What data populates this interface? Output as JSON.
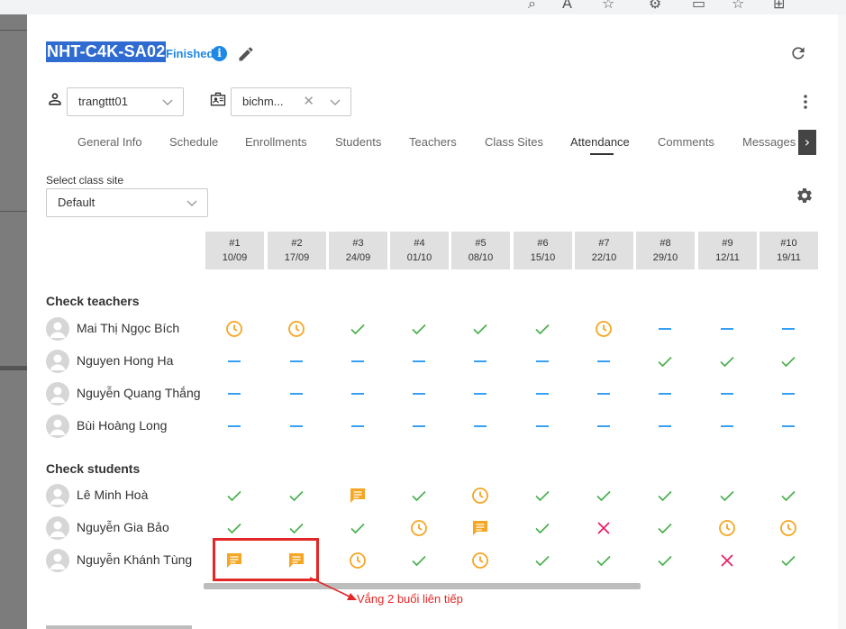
{
  "header": {
    "class_code": "NHT-C4K-SA02",
    "status": "Finished",
    "info_glyph": "i"
  },
  "assignees": {
    "owner": "trangttt01",
    "consultant": "bichm...",
    "clear_glyph": "✕"
  },
  "tabs": [
    {
      "label": "General Info"
    },
    {
      "label": "Schedule"
    },
    {
      "label": "Enrollments"
    },
    {
      "label": "Students"
    },
    {
      "label": "Teachers"
    },
    {
      "label": "Class Sites"
    },
    {
      "label": "Attendance",
      "active": true
    },
    {
      "label": "Comments"
    },
    {
      "label": "Messages"
    }
  ],
  "tab_scroll_glyph": "›",
  "class_site": {
    "label": "Select class site",
    "value": "Default"
  },
  "sessions": [
    {
      "num": "#1",
      "date": "10/09"
    },
    {
      "num": "#2",
      "date": "17/09"
    },
    {
      "num": "#3",
      "date": "24/09"
    },
    {
      "num": "#4",
      "date": "01/10"
    },
    {
      "num": "#5",
      "date": "08/10"
    },
    {
      "num": "#6",
      "date": "15/10"
    },
    {
      "num": "#7",
      "date": "22/10"
    },
    {
      "num": "#8",
      "date": "29/10"
    },
    {
      "num": "#9",
      "date": "12/11"
    },
    {
      "num": "#10",
      "date": "19/11"
    }
  ],
  "teachers_title": "Check teachers",
  "teachers": [
    {
      "name": "Mai Thị Ngọc Bích",
      "marks": [
        "late",
        "late",
        "present",
        "present",
        "present",
        "present",
        "late",
        "none",
        "none",
        "none"
      ]
    },
    {
      "name": "Nguyen Hong Ha",
      "marks": [
        "none",
        "none",
        "none",
        "none",
        "none",
        "none",
        "none",
        "present",
        "present",
        "present"
      ]
    },
    {
      "name": "Nguyễn Quang Thắng",
      "marks": [
        "none",
        "none",
        "none",
        "none",
        "none",
        "none",
        "none",
        "none",
        "none",
        "none"
      ]
    },
    {
      "name": "Bùi Hoàng Long",
      "marks": [
        "none",
        "none",
        "none",
        "none",
        "none",
        "none",
        "none",
        "none",
        "none",
        "none"
      ]
    }
  ],
  "students_title": "Check students",
  "students": [
    {
      "name": "Lê Minh Hoà",
      "marks": [
        "present",
        "present",
        "excused",
        "present",
        "late",
        "present",
        "present",
        "present",
        "present",
        "present"
      ]
    },
    {
      "name": "Nguyễn Gia Bảo",
      "marks": [
        "present",
        "present",
        "present",
        "late",
        "excused",
        "present",
        "absent",
        "present",
        "late",
        "late"
      ]
    },
    {
      "name": "Nguyễn Khánh Tùng",
      "marks": [
        "excused",
        "excused",
        "late",
        "present",
        "late",
        "present",
        "present",
        "present",
        "absent",
        "present"
      ]
    }
  ],
  "annotation": "Vắng 2 buổi liên tiếp",
  "colors": {
    "present": "#4caf50",
    "late": "#f5a623",
    "excused": "#f5a623",
    "absent": "#e91e63",
    "none": "#2196f3",
    "highlight": "#e32626",
    "selection": "#2f6bd1"
  }
}
